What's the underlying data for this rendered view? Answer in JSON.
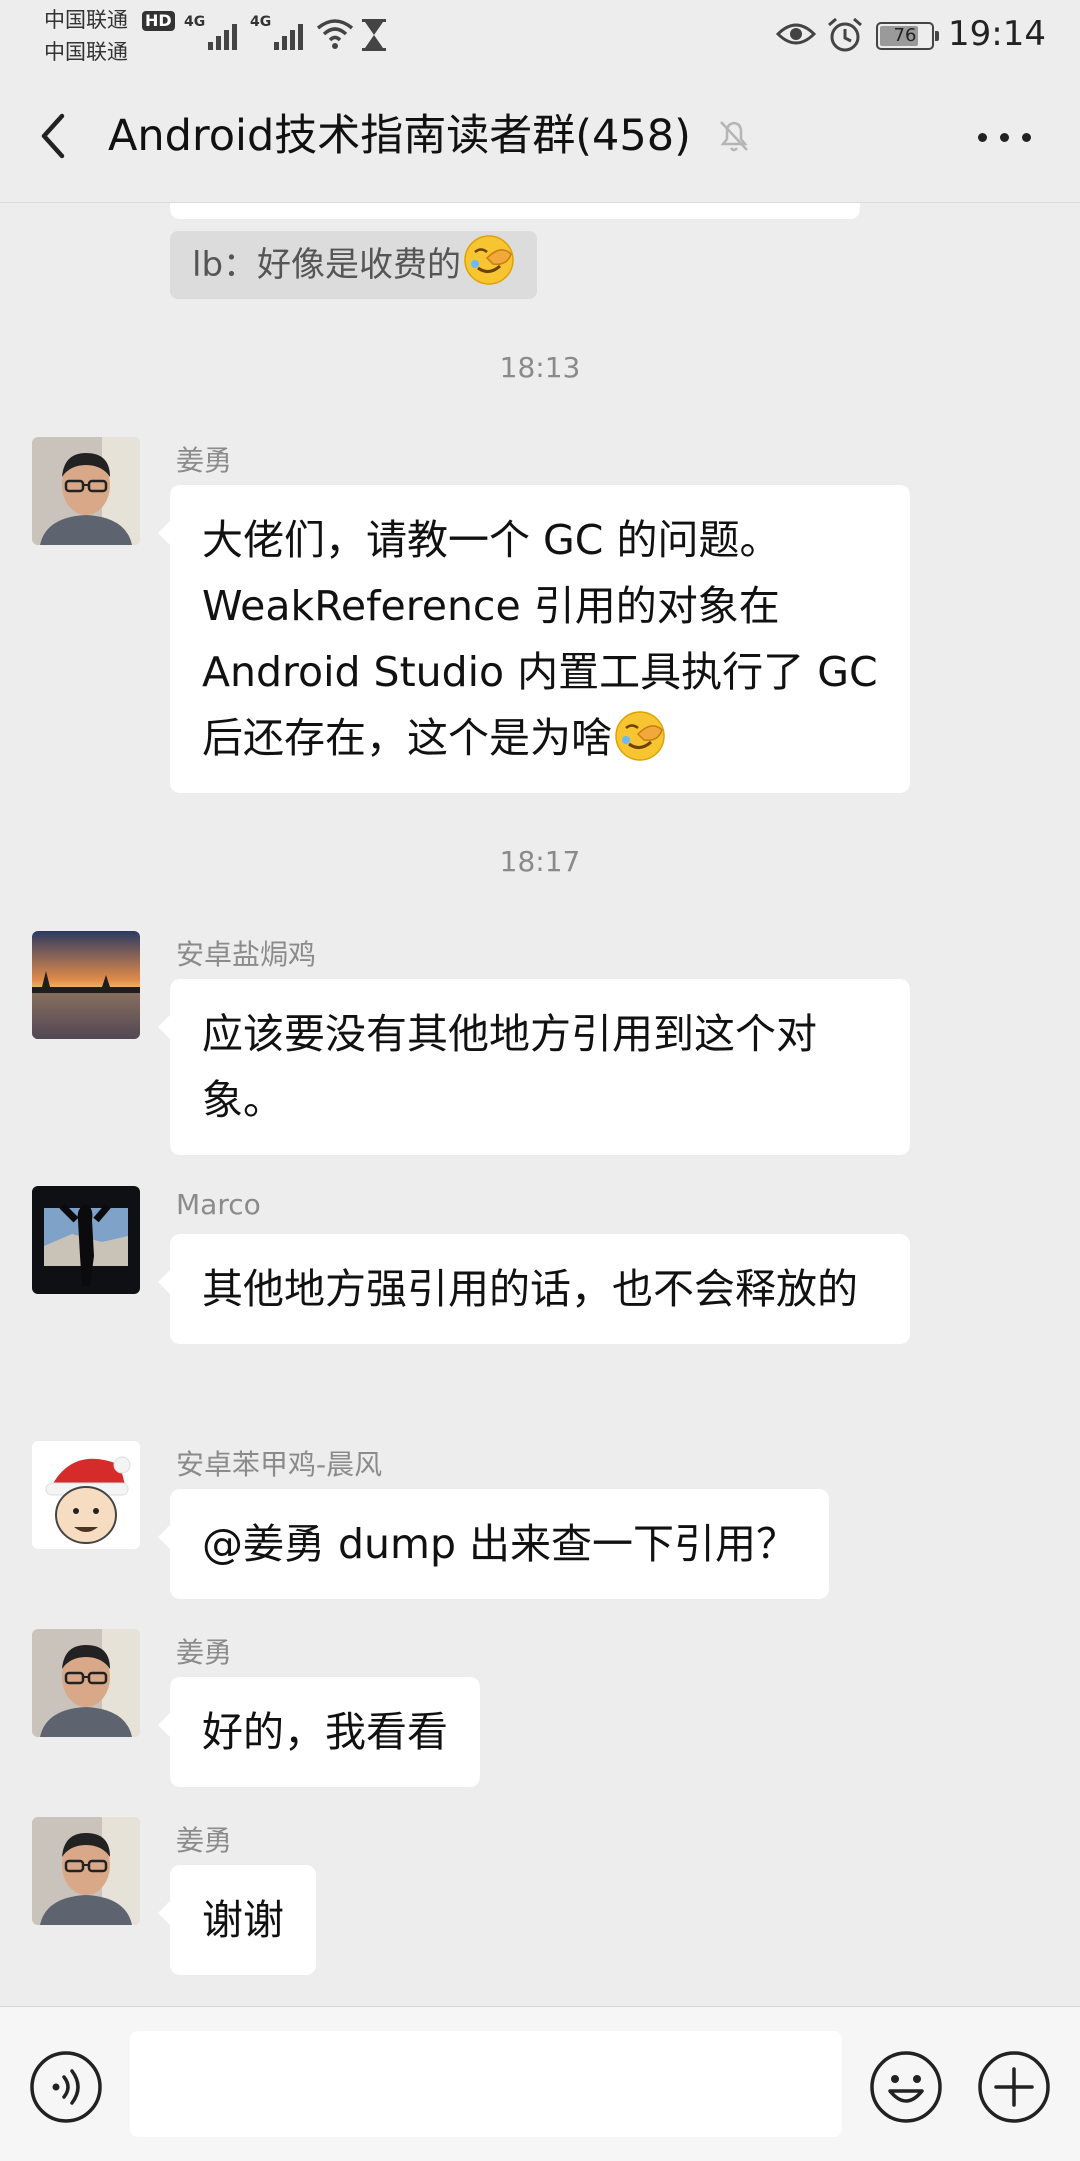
{
  "status_bar": {
    "carrier1": "中国联通",
    "carrier2": "中国联通",
    "hd_badge": "HD",
    "network1": "4G",
    "network2": "4G",
    "battery_level": 76,
    "battery_text": "76",
    "time": "19:14",
    "icons": [
      "signal-icon",
      "wifi-icon",
      "hourglass-icon",
      "eye-icon",
      "alarm-icon",
      "battery-icon"
    ]
  },
  "header": {
    "title": "Android技术指南读者群(458)",
    "icons": [
      "back-arrow-icon",
      "muted-bell-icon",
      "more-dots-icon"
    ]
  },
  "chat": {
    "quote": "lb：好像是收费的",
    "timestamps": [
      "18:13",
      "18:17"
    ],
    "messages": [
      {
        "sender": "姜勇",
        "text": "大佬们，请教一个 GC 的问题。WeakReference 引用的对象在 Android Studio 内置工具执行了 GC 后还存在，这个是为啥",
        "emoji": "facepalm-emoji",
        "avatar": "person-with-glasses"
      },
      {
        "sender": "安卓盐焗鸡",
        "text": "应该要没有其他地方引用到这个对象。",
        "avatar": "sunset-lake"
      },
      {
        "sender": "Marco",
        "text": "其他地方强引用的话，也不会释放的",
        "avatar": "silhouette-window"
      },
      {
        "sender": "安卓苯甲鸡-晨风",
        "text": "@姜勇  dump 出来查一下引用？",
        "avatar": "santa-hat-cartoon"
      },
      {
        "sender": "姜勇",
        "text": "好的，我看看",
        "avatar": "person-with-glasses"
      },
      {
        "sender": "姜勇",
        "text": "谢谢",
        "avatar": "person-with-glasses"
      }
    ]
  },
  "input_bar": {
    "value": "",
    "icons": [
      "voice-icon",
      "emoji-icon",
      "plus-icon"
    ]
  }
}
